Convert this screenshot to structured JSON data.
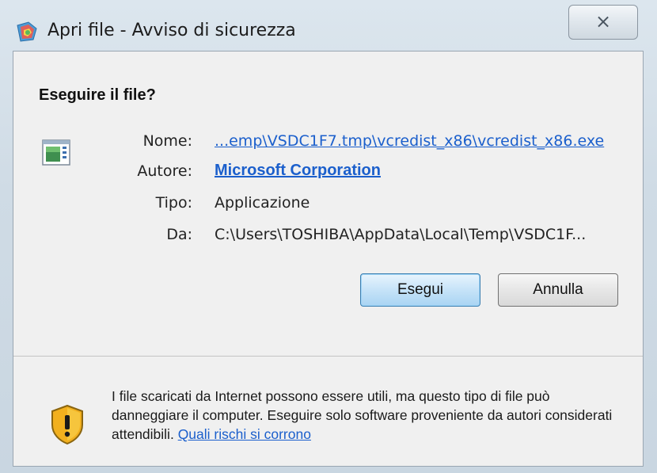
{
  "window": {
    "title": "Apri file - Avviso di sicurezza",
    "close_glyph": "⨯"
  },
  "dialog": {
    "question": "Eseguire il file?",
    "fields": {
      "name_label": "Nome:",
      "name_value": "...emp\\VSDC1F7.tmp\\vcredist_x86\\vcredist_x86.exe",
      "author_label": "Autore:",
      "author_value": "Microsoft Corporation",
      "type_label": "Tipo:",
      "type_value": "Applicazione",
      "from_label": "Da:",
      "from_value": "C:\\Users\\TOSHIBA\\AppData\\Local\\Temp\\VSDC1F..."
    },
    "buttons": {
      "run": "Esegui",
      "cancel": "Annulla"
    }
  },
  "footer": {
    "warning": "I file scaricati da Internet possono essere utili, ma questo tipo di file può danneggiare il computer. Eseguire solo software proveniente da autori considerati attendibili.",
    "risk_link": "Quali rischi si corrono"
  },
  "icons": {
    "title": "security-shield-icon",
    "file": "application-file-icon",
    "warning": "warning-shield-icon"
  },
  "colors": {
    "link": "#1b5fcc",
    "primary_button": "#c6e3f8",
    "warning_shield": "#f2b01e"
  }
}
